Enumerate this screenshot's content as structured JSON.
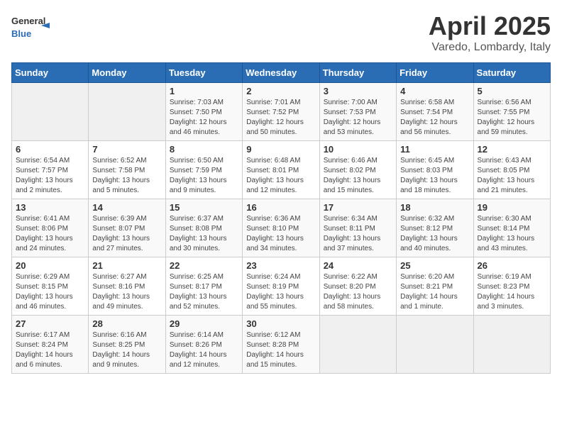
{
  "header": {
    "logo_general": "General",
    "logo_blue": "Blue",
    "month": "April 2025",
    "location": "Varedo, Lombardy, Italy"
  },
  "weekdays": [
    "Sunday",
    "Monday",
    "Tuesday",
    "Wednesday",
    "Thursday",
    "Friday",
    "Saturday"
  ],
  "weeks": [
    [
      {
        "day": null,
        "info": null
      },
      {
        "day": null,
        "info": null
      },
      {
        "day": "1",
        "info": "Sunrise: 7:03 AM\nSunset: 7:50 PM\nDaylight: 12 hours and 46 minutes."
      },
      {
        "day": "2",
        "info": "Sunrise: 7:01 AM\nSunset: 7:52 PM\nDaylight: 12 hours and 50 minutes."
      },
      {
        "day": "3",
        "info": "Sunrise: 7:00 AM\nSunset: 7:53 PM\nDaylight: 12 hours and 53 minutes."
      },
      {
        "day": "4",
        "info": "Sunrise: 6:58 AM\nSunset: 7:54 PM\nDaylight: 12 hours and 56 minutes."
      },
      {
        "day": "5",
        "info": "Sunrise: 6:56 AM\nSunset: 7:55 PM\nDaylight: 12 hours and 59 minutes."
      }
    ],
    [
      {
        "day": "6",
        "info": "Sunrise: 6:54 AM\nSunset: 7:57 PM\nDaylight: 13 hours and 2 minutes."
      },
      {
        "day": "7",
        "info": "Sunrise: 6:52 AM\nSunset: 7:58 PM\nDaylight: 13 hours and 5 minutes."
      },
      {
        "day": "8",
        "info": "Sunrise: 6:50 AM\nSunset: 7:59 PM\nDaylight: 13 hours and 9 minutes."
      },
      {
        "day": "9",
        "info": "Sunrise: 6:48 AM\nSunset: 8:01 PM\nDaylight: 13 hours and 12 minutes."
      },
      {
        "day": "10",
        "info": "Sunrise: 6:46 AM\nSunset: 8:02 PM\nDaylight: 13 hours and 15 minutes."
      },
      {
        "day": "11",
        "info": "Sunrise: 6:45 AM\nSunset: 8:03 PM\nDaylight: 13 hours and 18 minutes."
      },
      {
        "day": "12",
        "info": "Sunrise: 6:43 AM\nSunset: 8:05 PM\nDaylight: 13 hours and 21 minutes."
      }
    ],
    [
      {
        "day": "13",
        "info": "Sunrise: 6:41 AM\nSunset: 8:06 PM\nDaylight: 13 hours and 24 minutes."
      },
      {
        "day": "14",
        "info": "Sunrise: 6:39 AM\nSunset: 8:07 PM\nDaylight: 13 hours and 27 minutes."
      },
      {
        "day": "15",
        "info": "Sunrise: 6:37 AM\nSunset: 8:08 PM\nDaylight: 13 hours and 30 minutes."
      },
      {
        "day": "16",
        "info": "Sunrise: 6:36 AM\nSunset: 8:10 PM\nDaylight: 13 hours and 34 minutes."
      },
      {
        "day": "17",
        "info": "Sunrise: 6:34 AM\nSunset: 8:11 PM\nDaylight: 13 hours and 37 minutes."
      },
      {
        "day": "18",
        "info": "Sunrise: 6:32 AM\nSunset: 8:12 PM\nDaylight: 13 hours and 40 minutes."
      },
      {
        "day": "19",
        "info": "Sunrise: 6:30 AM\nSunset: 8:14 PM\nDaylight: 13 hours and 43 minutes."
      }
    ],
    [
      {
        "day": "20",
        "info": "Sunrise: 6:29 AM\nSunset: 8:15 PM\nDaylight: 13 hours and 46 minutes."
      },
      {
        "day": "21",
        "info": "Sunrise: 6:27 AM\nSunset: 8:16 PM\nDaylight: 13 hours and 49 minutes."
      },
      {
        "day": "22",
        "info": "Sunrise: 6:25 AM\nSunset: 8:17 PM\nDaylight: 13 hours and 52 minutes."
      },
      {
        "day": "23",
        "info": "Sunrise: 6:24 AM\nSunset: 8:19 PM\nDaylight: 13 hours and 55 minutes."
      },
      {
        "day": "24",
        "info": "Sunrise: 6:22 AM\nSunset: 8:20 PM\nDaylight: 13 hours and 58 minutes."
      },
      {
        "day": "25",
        "info": "Sunrise: 6:20 AM\nSunset: 8:21 PM\nDaylight: 14 hours and 1 minute."
      },
      {
        "day": "26",
        "info": "Sunrise: 6:19 AM\nSunset: 8:23 PM\nDaylight: 14 hours and 3 minutes."
      }
    ],
    [
      {
        "day": "27",
        "info": "Sunrise: 6:17 AM\nSunset: 8:24 PM\nDaylight: 14 hours and 6 minutes."
      },
      {
        "day": "28",
        "info": "Sunrise: 6:16 AM\nSunset: 8:25 PM\nDaylight: 14 hours and 9 minutes."
      },
      {
        "day": "29",
        "info": "Sunrise: 6:14 AM\nSunset: 8:26 PM\nDaylight: 14 hours and 12 minutes."
      },
      {
        "day": "30",
        "info": "Sunrise: 6:12 AM\nSunset: 8:28 PM\nDaylight: 14 hours and 15 minutes."
      },
      {
        "day": null,
        "info": null
      },
      {
        "day": null,
        "info": null
      },
      {
        "day": null,
        "info": null
      }
    ]
  ]
}
